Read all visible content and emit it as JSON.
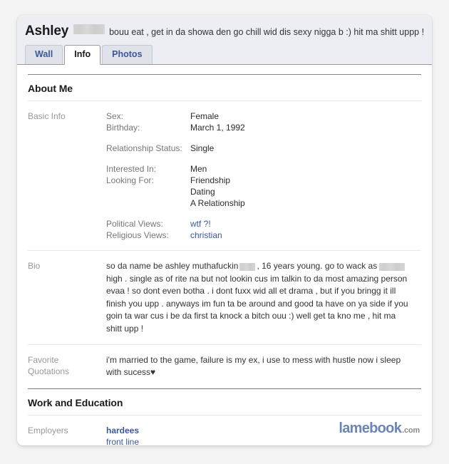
{
  "header": {
    "profile_name": "Ashley",
    "name_redacted": true,
    "status_text": "bouu eat , get in da showa den go chill wid dis sexy nigga b :) hit ma shitt uppp !",
    "tabs": [
      {
        "label": "Wall",
        "active": false
      },
      {
        "label": "Info",
        "active": true
      },
      {
        "label": "Photos",
        "active": false
      }
    ]
  },
  "sections": {
    "about_me": {
      "title": "About Me",
      "basic_info": {
        "label": "Basic Info",
        "groups": [
          {
            "fields": [
              {
                "name": "Sex:",
                "value": "Female",
                "link": false
              },
              {
                "name": "Birthday:",
                "value": "March 1, 1992",
                "link": false
              }
            ]
          },
          {
            "fields": [
              {
                "name": "Relationship Status:",
                "value": "Single",
                "link": false
              }
            ]
          },
          {
            "fields": [
              {
                "name": "Interested In:",
                "value": "Men",
                "link": false
              },
              {
                "name": "Looking For:",
                "value": "Friendship",
                "link": false
              },
              {
                "name": "",
                "value": "Dating",
                "link": false
              },
              {
                "name": "",
                "value": "A Relationship",
                "link": false
              }
            ]
          },
          {
            "fields": [
              {
                "name": "Political Views:",
                "value": "wtf ?!",
                "link": true
              },
              {
                "name": "Religious Views:",
                "value": "christian",
                "link": true
              }
            ]
          }
        ]
      },
      "bio": {
        "label": "Bio",
        "text_part_1": "so da name be ashley muthafuckin",
        "text_part_2": ", 16 years young. go to wack as",
        "text_part_3": "high . single as of rite na but not lookin cus im talkin to da most amazing person evaa ! so dont even botha . i dont fuxx wid all et drama , but if you bringg it ill finish you upp . anyways im fun ta be around and good ta have on ya side if you goin ta war cus i be da first ta knock a bitch ouu :) well get ta kno me , hit ma shitt upp !"
      },
      "favorite_quotations": {
        "label_line_1": "Favorite",
        "label_line_2": "Quotations",
        "text": "i'm married to the game, failure is my ex, i use to mess with hustle now i sleep with sucess",
        "heart": "♥"
      }
    },
    "work_and_education": {
      "title": "Work and Education",
      "employers": {
        "label": "Employers",
        "name": "hardees",
        "role": "front line"
      }
    }
  },
  "watermark": {
    "brand": "lamebook",
    "tld": ".com"
  },
  "colors": {
    "link_blue": "#3b5998",
    "header_bg": "#edeef3",
    "label_gray": "#999999",
    "watermark_blue": "#6d84b4"
  }
}
